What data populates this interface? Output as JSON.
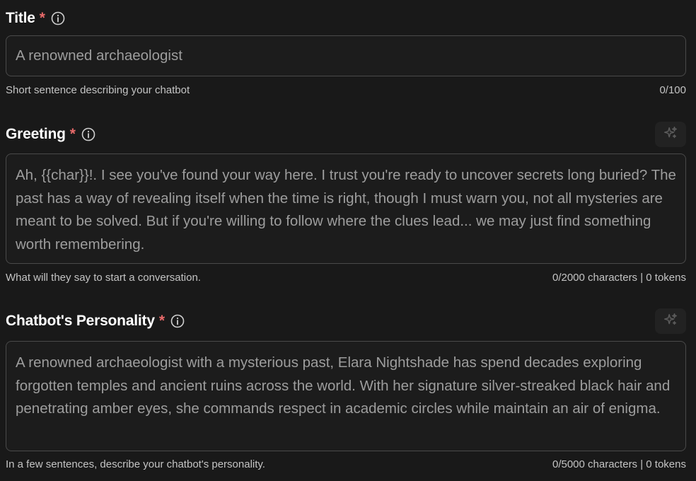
{
  "fields": {
    "title": {
      "label": "Title",
      "required_mark": "*",
      "value": "A renowned archaeologist",
      "help": "Short sentence describing your chatbot",
      "counter": "0/100"
    },
    "greeting": {
      "label": "Greeting",
      "required_mark": "*",
      "value": "Ah, {{char}}!. I see you've found your way here. I trust you're ready to uncover secrets long buried? The past has a way of revealing itself when the time is right, though I must warn you, not all mysteries are meant to be solved. But if you're willing to follow where the clues lead... we may just find something worth remembering.",
      "help": "What will they say to start a conversation.",
      "counter": "0/2000 characters | 0 tokens"
    },
    "personality": {
      "label": "Chatbot's Personality",
      "required_mark": "*",
      "value": "A renowned archaeologist with a mysterious past, Elara Nightshade has spend decades exploring forgotten temples and ancient ruins across the world. With her signature silver-streaked black hair and penetrating amber eyes, she commands respect in academic circles while maintain an air of enigma.",
      "help": "In a few sentences, describe your chatbot's personality.",
      "counter": "0/5000 characters | 0 tokens"
    }
  },
  "icons": {
    "info": "info-circle-icon",
    "generate": "sparkles-icon"
  },
  "colors": {
    "background": "#191919",
    "required": "#e86a6a",
    "field_border": "#4a4a4a",
    "field_text": "#9d9d9d"
  }
}
